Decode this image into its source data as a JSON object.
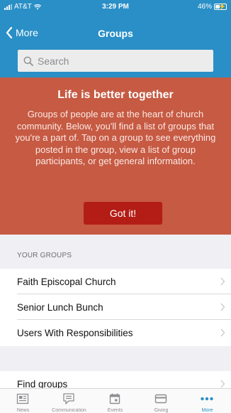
{
  "status_bar": {
    "carrier": "AT&T",
    "time": "3:29 PM",
    "battery": "46%",
    "battery_level": 0.46
  },
  "nav": {
    "back_label": "More",
    "title": "Groups"
  },
  "search": {
    "placeholder": "Search"
  },
  "banner": {
    "title": "Life is better together",
    "text": "Groups of people are at the heart of church community. Below, you'll find a list of groups that you're a part of. Tap on a group to see everything posted in the group, view a list of group participants, or get general information.",
    "button_label": "Got it!"
  },
  "groups_section": {
    "header": "YOUR GROUPS",
    "items": [
      {
        "label": "Faith Episcopal Church"
      },
      {
        "label": "Senior Lunch Bunch"
      },
      {
        "label": "Users With Responsibilities"
      }
    ]
  },
  "find_groups": {
    "label": "Find groups"
  },
  "tab_bar": {
    "tabs": [
      {
        "label": "News",
        "icon": "news-icon",
        "active": false
      },
      {
        "label": "Communication",
        "icon": "chat-icon",
        "active": false
      },
      {
        "label": "Events",
        "icon": "calendar-icon",
        "active": false
      },
      {
        "label": "Giving",
        "icon": "card-icon",
        "active": false
      },
      {
        "label": "More",
        "icon": "more-icon",
        "active": true
      }
    ]
  },
  "colors": {
    "header": "#2a8fc6",
    "banner": "#c65a43",
    "button": "#b31d16",
    "active_tab": "#2a8fc6"
  }
}
